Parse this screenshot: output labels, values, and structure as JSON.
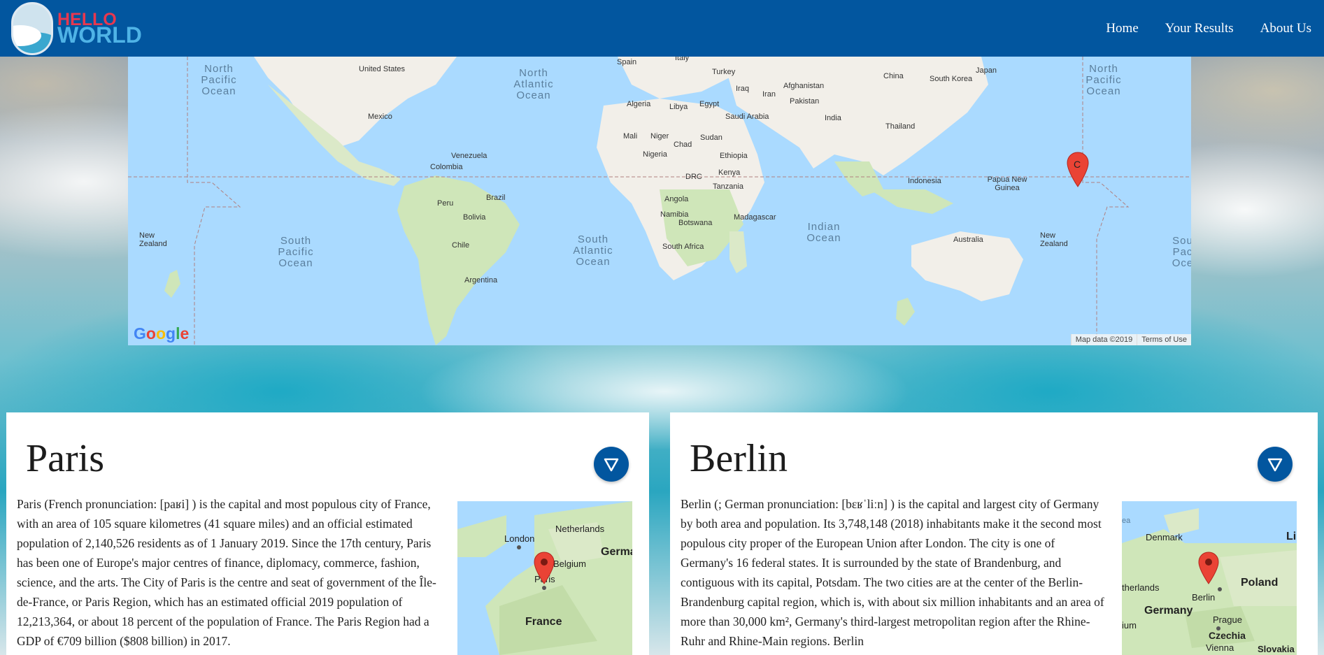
{
  "header": {
    "logo_line1": "HELLO",
    "logo_line2": "WORLD",
    "nav": [
      {
        "label": "Home"
      },
      {
        "label": "Your Results"
      },
      {
        "label": "About Us"
      }
    ]
  },
  "world_map": {
    "countries": [
      "United States",
      "Mexico",
      "Venezuela",
      "Colombia",
      "Peru",
      "Brazil",
      "Bolivia",
      "Chile",
      "Argentina",
      "Spain",
      "Italy",
      "Turkey",
      "Iraq",
      "Iran",
      "Afghanistan",
      "Pakistan",
      "India",
      "China",
      "South Korea",
      "Japan",
      "Thailand",
      "Algeria",
      "Libya",
      "Egypt",
      "Saudi Arabia",
      "Mali",
      "Niger",
      "Chad",
      "Sudan",
      "Nigeria",
      "Ethiopia",
      "Kenya",
      "DRC",
      "Tanzania",
      "Angola",
      "Namibia",
      "Botswana",
      "Madagascar",
      "South Africa",
      "Indonesia",
      "Papua New Guinea",
      "Australia",
      "New Zealand"
    ],
    "oceans": {
      "north_pacific": "North Pacific Ocean",
      "north_atlantic": "North Atlantic Ocean",
      "south_pacific": "South Pacific Ocean",
      "south_atlantic": "South Atlantic Ocean",
      "indian": "Indian Ocean",
      "south_partial": "Sou Pac Oce"
    },
    "marker_label": "C",
    "google": "Google",
    "map_data": "Map data ©2019",
    "terms": "Terms of Use",
    "colors": {
      "water": "#aadaff",
      "land": "#f2efe9",
      "green": "#cfe6b9",
      "marker": "#ea4335"
    }
  },
  "cards": [
    {
      "title": "Paris",
      "text": "Paris (French pronunciation: [paʁi] ) is the capital and most populous city of France, with an area of 105 square kilometres (41 square miles) and an official estimated population of 2,140,526 residents as of 1 January 2019. Since the 17th century, Paris has been one of Europe's major centres of finance, diplomacy, commerce, fashion, science, and the arts. The City of Paris is the centre and seat of government of the Île-de-France, or Paris Region, which has an estimated official 2019 population of 12,213,364, or about 18 percent of the population of France. The Paris Region had a GDP of €709 billion ($808 billion) in 2017.",
      "map_labels": {
        "london": "London",
        "netherlands": "Netherlands",
        "belgium": "Belgium",
        "germany": "Germa",
        "paris": "Paris",
        "france": "France"
      }
    },
    {
      "title": "Berlin",
      "text": "Berlin (; German pronunciation: [bɛʁˈliːn] ) is the capital and largest city of Germany by both area and population. Its 3,748,148 (2018) inhabitants make it the second most populous city proper of the European Union after London. The city is one of Germany's 16 federal states. It is surrounded by the state of Brandenburg, and contiguous with its capital, Potsdam. The two cities are at the center of the Berlin-Brandenburg capital region, which is, with about six million inhabitants and an area of more than 30,000 km², Germany's third-largest metropolitan region after the Rhine-Ruhr and Rhine-Main regions. Berlin",
      "map_labels": {
        "sea": "ea",
        "denmark": "Denmark",
        "li": "Li",
        "netherlands": "therlands",
        "poland": "Poland",
        "berlin": "Berlin",
        "germany": "Germany",
        "prague": "Prague",
        "czechia": "Czechia",
        "ium": "ium",
        "vienna": "Vienna",
        "slovakia": "Slovakia"
      }
    }
  ]
}
